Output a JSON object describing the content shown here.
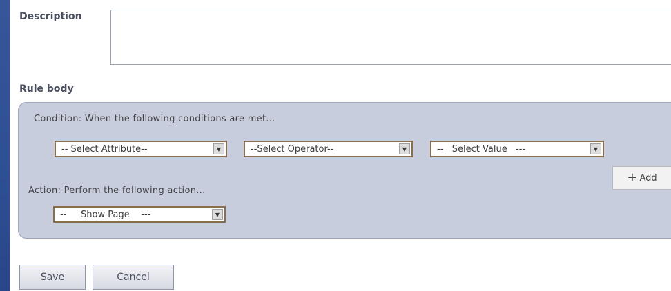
{
  "form": {
    "description_label": "Description",
    "description_value": "",
    "rule_body_label": "Rule body"
  },
  "rule": {
    "condition_text": "Condition: When the following conditions are met...",
    "attribute_select": "-- Select Attribute--",
    "operator_select": "--Select Operator--",
    "value_select": "--   Select Value   ---",
    "add_label": "Add",
    "action_text": "Action: Perform the following action...",
    "action_select": "--     Show Page    ---"
  },
  "buttons": {
    "save": "Save",
    "cancel": "Cancel"
  }
}
